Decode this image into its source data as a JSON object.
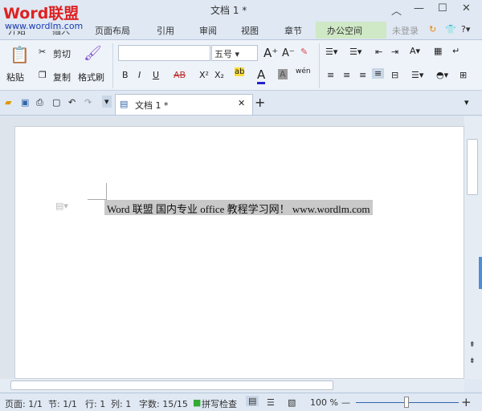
{
  "watermark": {
    "logo": "Word联盟",
    "url": "www.wordlm.com"
  },
  "title": "文档 1 *",
  "tabs": [
    "开始",
    "插入",
    "页面布局",
    "引用",
    "审阅",
    "视图",
    "章节",
    "办公空间"
  ],
  "login": "未登录",
  "ribbon": {
    "paste": "粘贴",
    "cut": "剪切",
    "copy": "复制",
    "format_painter": "格式刷",
    "font_name": "",
    "font_size": "五号",
    "bold": "B",
    "italic": "I",
    "underline": "U",
    "strike": "AB",
    "sup": "X²",
    "sub": "X₂",
    "font_color": "A",
    "shade": "A",
    "pinyin": "wén"
  },
  "doc_tab": "文档 1 *",
  "document": {
    "text": "Word 联盟  国内专业 office 教程学习网！ www.wordlm.com"
  },
  "status": {
    "page": "页面: 1/1",
    "section": "节: 1/1",
    "row": "行: 1",
    "col": "列: 1",
    "words": "字数: 15/15",
    "spell": "拼写检查",
    "zoom": "100 %"
  },
  "zoom_level_percent": 100
}
